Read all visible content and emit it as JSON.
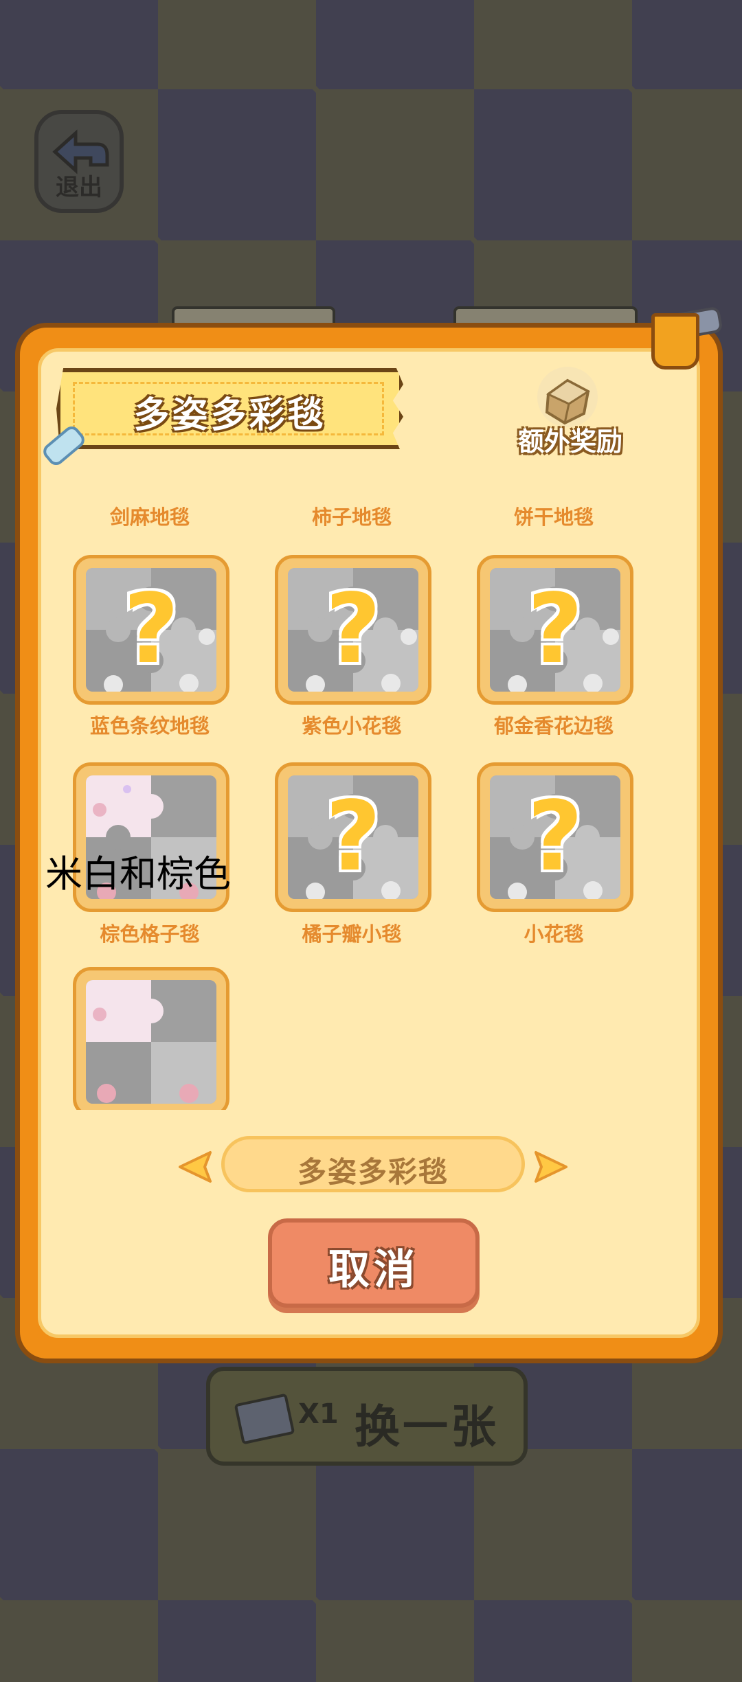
{
  "background": {
    "exit_label": "退出"
  },
  "swap_button": {
    "count": "X1",
    "label": "换一张"
  },
  "panel": {
    "title": "多姿多彩毯",
    "reward_label": "额外奖励",
    "top_labels": [
      "剑麻地毯",
      "柿子地毯",
      "饼干地毯"
    ],
    "row1_labels": [
      "蓝色条纹地毯",
      "紫色小花毯",
      "郁金香花边毯"
    ],
    "row2_labels": [
      "棕色格子毯",
      "橘子瓣小毯",
      "小花毯"
    ],
    "tile_question_mark": "?",
    "overlay_text": "米白和棕色",
    "selector_text": "多姿多彩毯",
    "cancel_label": "取消"
  },
  "colors": {
    "panel_orange": "#f08e16",
    "panel_cream": "#ffeab0",
    "label_orange": "#e58a2d",
    "cancel_button": "#ef8a65",
    "question_yellow": "#ffc630"
  },
  "icons": [
    "exit-arrow-icon",
    "bandage-icon",
    "reward-chest-icon",
    "puzzle-icon",
    "arrow-left-icon",
    "arrow-right-icon",
    "bucket-icon",
    "card-icon"
  ]
}
